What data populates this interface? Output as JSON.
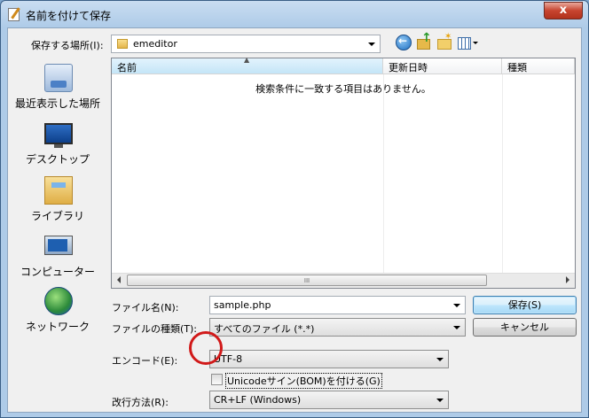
{
  "window": {
    "title": "名前を付けて保存",
    "close_label": "x"
  },
  "location": {
    "label": "保存する場所(I):",
    "value": "emeditor"
  },
  "toolbar": {
    "back_icon": "back-arrow-icon",
    "up_icon": "up-folder-icon",
    "new_folder_icon": "new-folder-icon",
    "view_icon": "view-menu-icon"
  },
  "places": [
    {
      "name": "最近表示した場所",
      "icon": "recent-places-icon"
    },
    {
      "name": "デスクトップ",
      "icon": "desktop-icon"
    },
    {
      "name": "ライブラリ",
      "icon": "libraries-icon"
    },
    {
      "name": "コンピューター",
      "icon": "computer-icon"
    },
    {
      "name": "ネットワーク",
      "icon": "network-icon"
    }
  ],
  "filelist": {
    "columns": [
      "名前",
      "更新日時",
      "種類"
    ],
    "empty_message": "検索条件に一致する項目はありません。",
    "scroll_thumb": "III"
  },
  "filename": {
    "label": "ファイル名(N):",
    "value": "sample.php"
  },
  "filetype": {
    "label": "ファイルの種類(T):",
    "value": "すべてのファイル (*.*)"
  },
  "encoding": {
    "label": "エンコード(E):",
    "value": "UTF-8"
  },
  "bom": {
    "label": "Unicodeサイン(BOM)を付ける(G)",
    "checked": false
  },
  "linebreak": {
    "label": "改行方法(R):",
    "value": "CR+LF (Windows)"
  },
  "buttons": {
    "save": "保存(S)",
    "cancel": "キャンセル"
  },
  "colors": {
    "accent": "#3c7fb1",
    "annotation": "#d11919"
  }
}
